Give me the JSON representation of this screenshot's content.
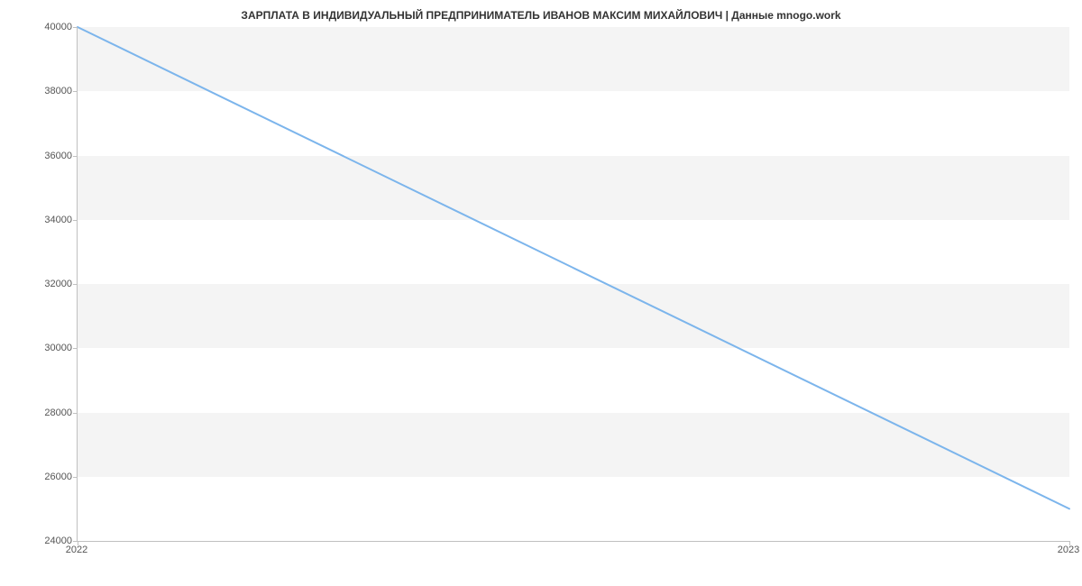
{
  "chart_data": {
    "type": "line",
    "title": "ЗАРПЛАТА В ИНДИВИДУАЛЬНЫЙ ПРЕДПРИНИМАТЕЛЬ ИВАНОВ МАКСИМ МИХАЙЛОВИЧ | Данные mnogo.work",
    "x": [
      2022,
      2023
    ],
    "values": [
      40000,
      25000
    ],
    "x_ticks": [
      2022,
      2023
    ],
    "y_ticks": [
      24000,
      26000,
      28000,
      30000,
      32000,
      34000,
      36000,
      38000,
      40000
    ],
    "xlim": [
      2022,
      2023
    ],
    "ylim": [
      24000,
      40000
    ],
    "line_color": "#7cb5ec",
    "band_color": "#f4f4f4"
  }
}
